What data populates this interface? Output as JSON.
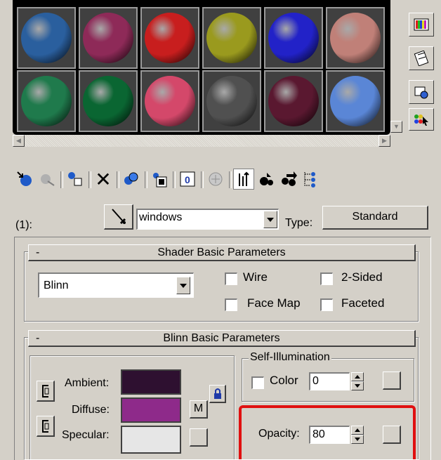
{
  "slots": [
    {
      "color": "#2a5f9e"
    },
    {
      "color": "#8e2a58"
    },
    {
      "color": "#c81e1e"
    },
    {
      "color": "#9a9a1e"
    },
    {
      "color": "#2222c8"
    },
    {
      "color": "#c08078"
    },
    {
      "color": "#1f7a4c"
    },
    {
      "color": "#0a6632"
    },
    {
      "color": "#d4486a"
    },
    {
      "color": "#505050"
    },
    {
      "color": "#5a1830"
    },
    {
      "color": "#5a86d6"
    }
  ],
  "material": {
    "index_label": "(1):",
    "name": "windows",
    "type_label": "Type:",
    "type_value": "Standard"
  },
  "shader_basic": {
    "title": "Shader Basic Parameters",
    "collapse": "-",
    "shader": "Blinn",
    "wire": "Wire",
    "two_sided": "2-Sided",
    "face_map": "Face Map",
    "faceted": "Faceted"
  },
  "blinn_basic": {
    "title": "Blinn Basic Parameters",
    "collapse": "-",
    "ambient_label": "Ambient:",
    "ambient_color": "#2e1030",
    "diffuse_label": "Diffuse:",
    "diffuse_color": "#8e2a8a",
    "specular_label": "Specular:",
    "specular_color": "#e6e6e6",
    "map_button": "M",
    "self_illum_title": "Self-Illumination",
    "color_label": "Color",
    "self_illum_value": "0",
    "opacity_label": "Opacity:",
    "opacity_value": "80"
  },
  "icons": [
    "get-material-icon",
    "put-to-scene-icon",
    "assign-material-icon",
    "reset-icon",
    "make-copy-icon",
    "make-unique-icon",
    "put-to-library-icon",
    "material-effects-channel-icon",
    "show-map-icon",
    "show-end-result-icon",
    "go-to-parent-icon",
    "go-forward-sibling-icon",
    "material-navigator-icon"
  ],
  "accent": {
    "highlight_box": "#e01010"
  }
}
